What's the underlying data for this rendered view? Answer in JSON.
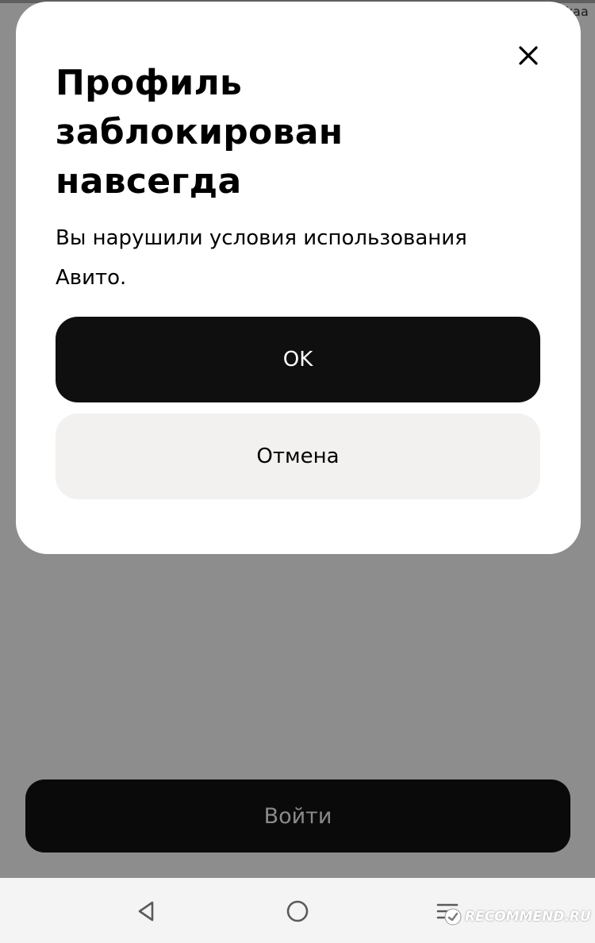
{
  "watermark": {
    "user": "Kmilkaa",
    "site": "RECOMMEND.RU"
  },
  "dialog": {
    "title_line1": "Профиль",
    "title_line2": "заблокирован",
    "title_line3": "навсегда",
    "text_line1": "Вы нарушили условия использования",
    "text_line2": "Авито.",
    "ok_label": "OK",
    "cancel_label": "Отмена",
    "close_icon": "close-icon"
  },
  "background": {
    "login_label": "Войти"
  },
  "nav": {
    "back_icon": "back-triangle-icon",
    "home_icon": "home-circle-icon",
    "menu_icon": "menu-lines-icon"
  },
  "colors": {
    "overlay": "#8d8d8d",
    "primary_button": "#0f0f0f",
    "secondary_button": "#f2f1ef",
    "modal": "#ffffff"
  }
}
